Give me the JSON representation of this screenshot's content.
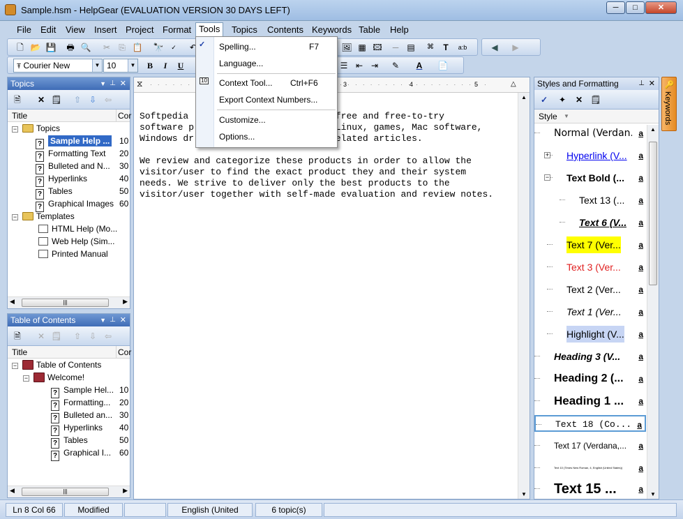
{
  "window": {
    "title": "Sample.hsm - HelpGear (EVALUATION VERSION 30 DAYS LEFT)",
    "min": "─",
    "max": "□",
    "close": "✕"
  },
  "menu": [
    "File",
    "Edit",
    "View",
    "Insert",
    "Project",
    "Format",
    "Tools",
    "Topics",
    "Contents",
    "Keywords",
    "Table",
    "Help"
  ],
  "font_combo": {
    "family": "Courier New",
    "size": "10"
  },
  "tools_menu": {
    "items": [
      {
        "label": "Spelling...",
        "shortcut": "F7"
      },
      {
        "label": "Language...",
        "shortcut": ""
      },
      {
        "label": "Context Tool...",
        "shortcut": "Ctrl+F6"
      },
      {
        "label": "Export Context Numbers...",
        "shortcut": ""
      },
      {
        "label": "Customize...",
        "shortcut": ""
      },
      {
        "label": "Options...",
        "shortcut": ""
      }
    ]
  },
  "topics_panel": {
    "title": "Topics",
    "col_title": "Title",
    "col_context": "Cor",
    "topics_folder": "Topics",
    "items": [
      {
        "label": "Sample Help ...",
        "num": "10"
      },
      {
        "label": "Formatting Text",
        "num": "20"
      },
      {
        "label": "Bulleted and N...",
        "num": "30"
      },
      {
        "label": "Hyperlinks",
        "num": "40"
      },
      {
        "label": "Tables",
        "num": "50"
      },
      {
        "label": "Graphical Images",
        "num": "60"
      }
    ],
    "templates_folder": "Templates",
    "templates": [
      "HTML Help (Mo...",
      "Web Help (Sim...",
      "Printed Manual"
    ]
  },
  "toc_panel": {
    "title": "Table of Contents",
    "col_title": "Title",
    "col_context": "Cor",
    "root": "Table of Contents",
    "welcome": "Welcome!",
    "items": [
      {
        "label": "Sample Hel...",
        "num": "10"
      },
      {
        "label": "Formatting...",
        "num": "20"
      },
      {
        "label": "Bulleted an...",
        "num": "30"
      },
      {
        "label": "Hyperlinks",
        "num": "40"
      },
      {
        "label": "Tables",
        "num": "50"
      },
      {
        "label": "Graphical I...",
        "num": "60"
      }
    ]
  },
  "editor": {
    "ruler_marks": [
      "1",
      "2",
      "3",
      "4",
      "5"
    ],
    "lines": [
      "Softpedia                       000 free and free-to-try",
      "software p                      nix/Linux, games, Mac software,",
      "Windows dr                      IT-related articles.",
      "",
      "We review and categorize these products in order to allow the",
      "visitor/user to find the exact product they and their system",
      "needs. We strive to deliver only the best products to the",
      "visitor/user together with self-made evaluation and review notes."
    ]
  },
  "styles_panel": {
    "title": "Styles and Formatting",
    "col_style": "Style",
    "sample_mark": "a",
    "styles": [
      {
        "label": "Normal (Verdan..."
      },
      {
        "label": "Hyperlink (V..."
      },
      {
        "label": "Text Bold (..."
      },
      {
        "label": "Text 13 (..."
      },
      {
        "label": "Text 6 (V..."
      },
      {
        "label": "Text 7 (Ver..."
      },
      {
        "label": "Text 3 (Ver..."
      },
      {
        "label": "Text 2 (Ver..."
      },
      {
        "label": "Text 1 (Ver..."
      },
      {
        "label": "Highlight (V..."
      },
      {
        "label": "Heading 3 (V..."
      },
      {
        "label": "Heading 2 (..."
      },
      {
        "label": "Heading 1 ..."
      },
      {
        "label": "Text 18 (Co..."
      },
      {
        "label": "Text 17 (Verdana,..."
      },
      {
        "label": "Text 10 (Times New Roman, 4, English (United States))"
      },
      {
        "label": "Text 15 ..."
      }
    ],
    "highlight_yellow": "#ffff00",
    "highlight_blue": "#c7d5f4",
    "red": "#e02020",
    "link": "#0000ee"
  },
  "keywords_tab": "Keywords",
  "status": {
    "position": "Ln 8 Col 66",
    "modified": "Modified",
    "language": "English (United States)",
    "topics": "6 topic(s)"
  }
}
